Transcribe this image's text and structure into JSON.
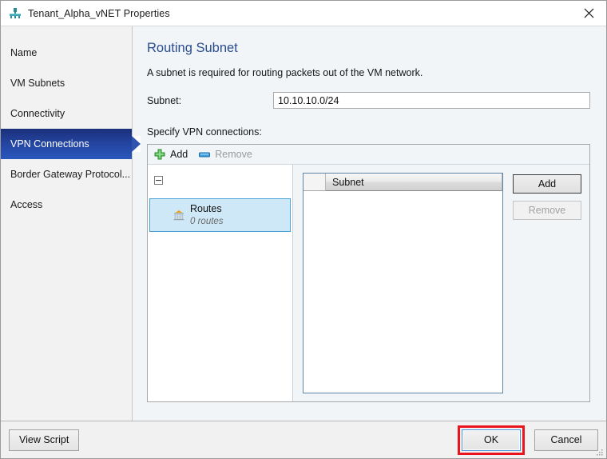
{
  "window": {
    "title": "Tenant_Alpha_vNET Properties",
    "title_icon": "network-hub-icon",
    "close_icon": "close-icon"
  },
  "sidebar": {
    "items": [
      {
        "label": "Name",
        "selected": false
      },
      {
        "label": "VM Subnets",
        "selected": false
      },
      {
        "label": "Connectivity",
        "selected": false
      },
      {
        "label": "VPN Connections",
        "selected": true
      },
      {
        "label": "Border Gateway Protocol...",
        "selected": false
      },
      {
        "label": "Access",
        "selected": false
      }
    ]
  },
  "main": {
    "title": "Routing Subnet",
    "description": "A subnet is required for routing packets out of the VM network.",
    "subnet": {
      "label": "Subnet:",
      "value": "10.10.10.0/24",
      "placeholder": ""
    },
    "specify_label": "Specify VPN connections:",
    "toolbar": {
      "add_label": "Add",
      "add_icon": "plus-icon",
      "remove_label": "Remove",
      "remove_icon": "minus-icon",
      "remove_enabled": false
    },
    "tree": {
      "expander_state": "expanded",
      "node": {
        "title": "Routes",
        "subtitle": "0 routes",
        "icon": "routes-gateway-icon",
        "selected": true
      }
    },
    "grid": {
      "columns": [
        "Subnet"
      ],
      "rows": []
    },
    "grid_buttons": [
      {
        "label": "Add",
        "enabled": true,
        "default": true
      },
      {
        "label": "Remove",
        "enabled": false,
        "default": false
      }
    ]
  },
  "footer": {
    "view_script_label": "View Script",
    "ok_label": "OK",
    "cancel_label": "Cancel"
  },
  "colors": {
    "accent_blue": "#2a4d8f",
    "selected_nav": "#23439e",
    "annotation_red": "#e8141e",
    "focus_blue": "#4a90d9",
    "tree_select_fill": "#cfe8f7",
    "plus_green": "#3faa3f",
    "minus_blue": "#2e8fd4"
  }
}
